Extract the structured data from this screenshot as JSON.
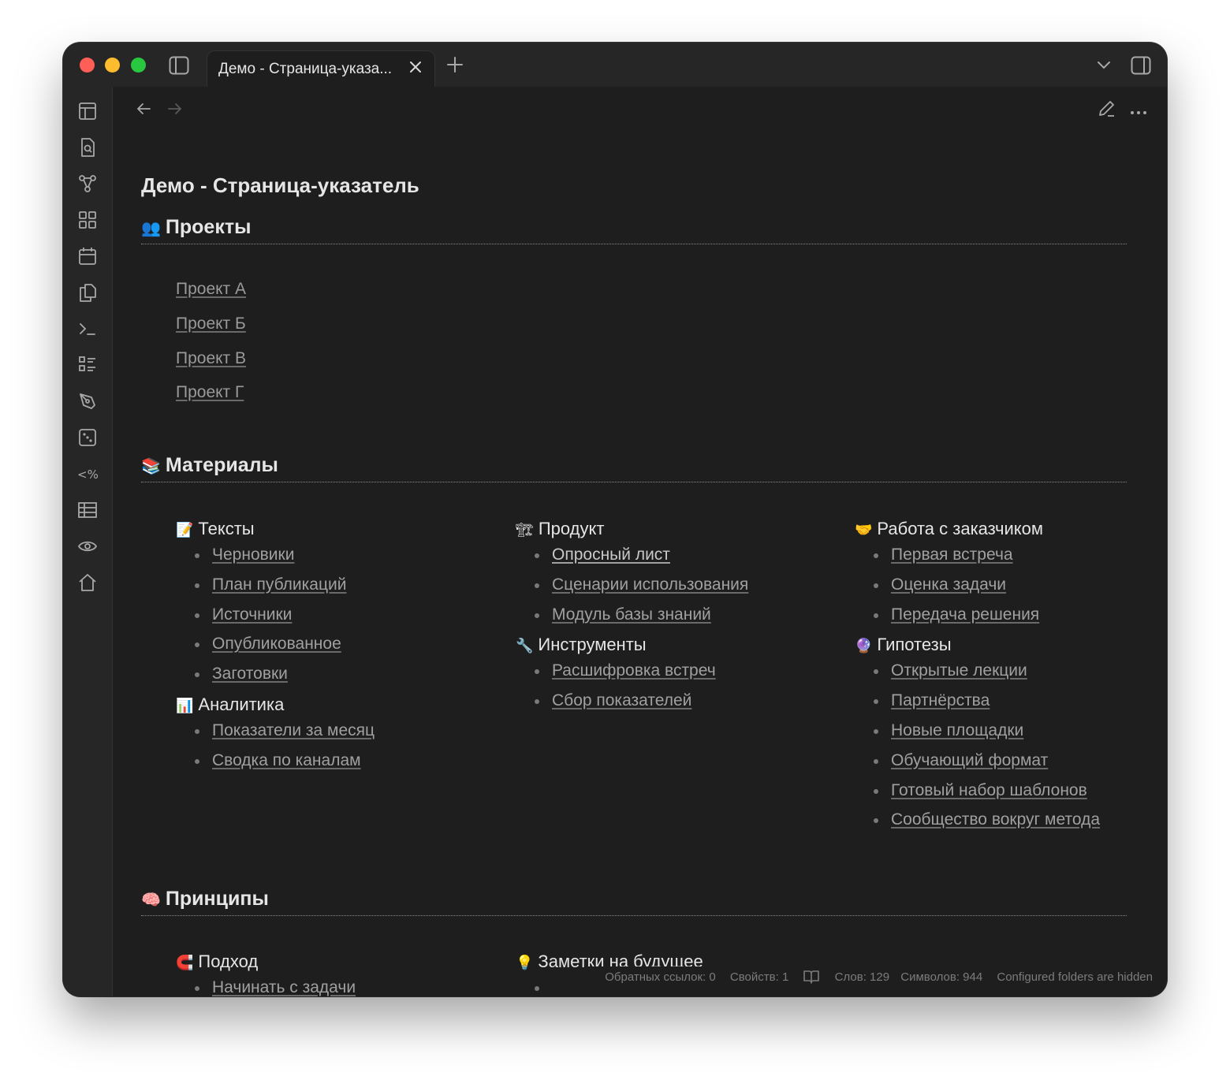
{
  "window": {
    "tab_title": "Демо - Страница-указа...",
    "new_tab_label": "+"
  },
  "page": {
    "title": "Демо - Страница-указатель"
  },
  "sections": {
    "projects": {
      "emoji": "👥",
      "title": "Проекты",
      "links": [
        "Проект А",
        "Проект Б",
        "Проект В",
        "Проект Г"
      ]
    },
    "materials": {
      "emoji": "📚",
      "title": "Материалы",
      "col1": {
        "group1": {
          "emoji": "📝",
          "title": "Тексты",
          "items": [
            "Черновики",
            "План публикаций",
            "Источники",
            "Опубликованное",
            "Заготовки"
          ]
        },
        "group2": {
          "emoji": "📊",
          "title": "Аналитика",
          "items": [
            "Показатели за месяц",
            "Сводка по каналам"
          ]
        }
      },
      "col2": {
        "group1": {
          "emoji": "🏗",
          "title": "Продукт",
          "items": [
            "Опросный лист",
            "Сценарии использования",
            "Модуль базы знаний"
          ]
        },
        "group2": {
          "emoji": "🔧",
          "title": "Инструменты",
          "items": [
            "Расшифровка встреч",
            "Сбор показателей"
          ]
        }
      },
      "col3": {
        "group1": {
          "emoji": "🤝",
          "title": "Работа с заказчиком",
          "items": [
            "Первая встреча",
            "Оценка задачи",
            "Передача решения"
          ]
        },
        "group2": {
          "emoji": "🔮",
          "title": "Гипотезы",
          "items": [
            "Открытые лекции",
            "Партнёрства",
            "Новые площадки",
            "Обучающий формат",
            "Готовый набор шаблонов",
            "Сообщество вокруг метода"
          ]
        }
      }
    },
    "principles": {
      "emoji": "🧠",
      "title": "Принципы",
      "col1": {
        "emoji": "🧲",
        "title": "Подход",
        "items": [
          "Начинать с задачи"
        ]
      },
      "col2": {
        "emoji": "💡",
        "title": "Заметки на будущее"
      }
    }
  },
  "statusbar": {
    "backlinks": "Обратных ссылок: 0",
    "properties": "Свойств: 1",
    "words": "Слов: 129",
    "chars": "Символов: 944",
    "hidden": "Configured folders are hidden"
  },
  "ribbon_icons": [
    "layout-icon",
    "file-search-icon",
    "graph-icon",
    "grid-icon",
    "calendar-icon",
    "copy-icon",
    "terminal-icon",
    "list-icon",
    "pen-tool-icon",
    "dice-icon",
    "templater-icon",
    "table-icon",
    "eye-icon",
    "home-icon"
  ],
  "colors": {
    "background": "#1e1e1e",
    "chrome": "#262626",
    "text": "#e6e6e6",
    "link": "#a0a0a0"
  }
}
